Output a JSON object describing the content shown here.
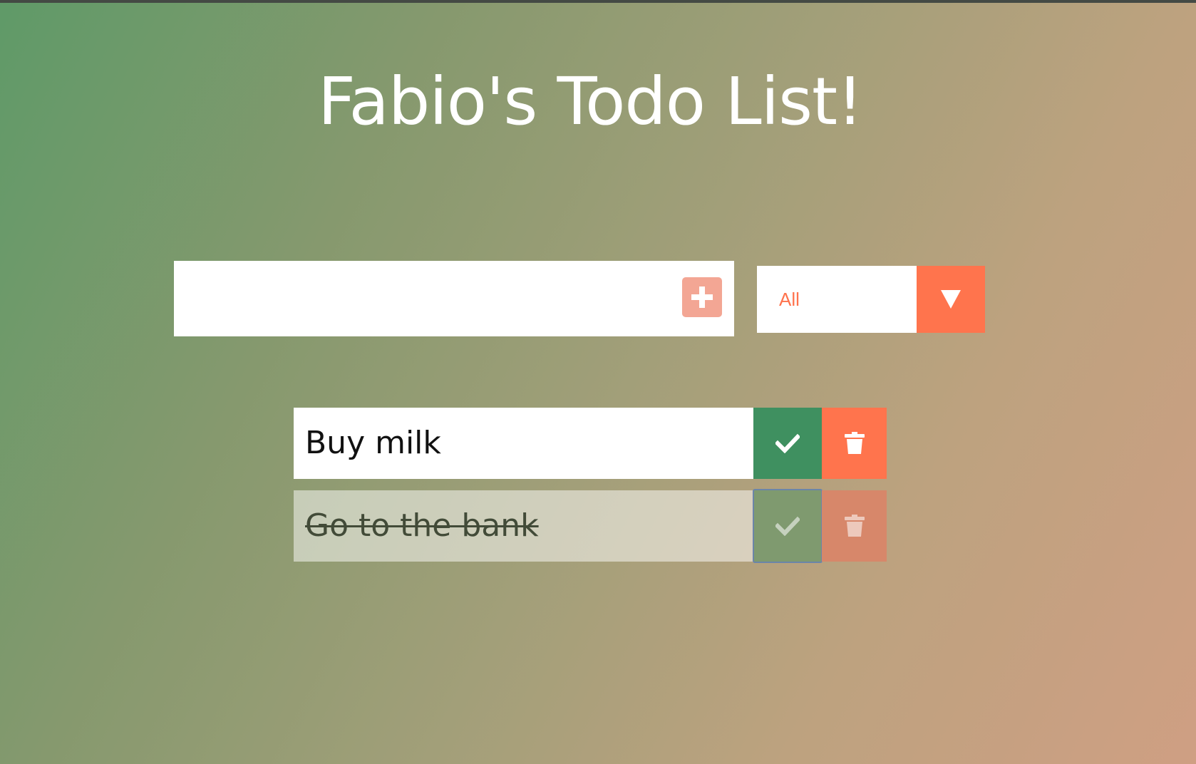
{
  "window": {
    "title": "Fabio's Todo List!"
  },
  "new_todo": {
    "value": "",
    "add_icon": "plus-square-icon"
  },
  "filter": {
    "selected": "All",
    "arrow_icon": "triangle-down-icon"
  },
  "todos": [
    {
      "text": "Buy milk",
      "completed": false,
      "check_icon": "check-icon",
      "delete_icon": "trash-icon"
    },
    {
      "text": "Go to the bank",
      "completed": true,
      "check_icon": "check-icon",
      "delete_icon": "trash-icon"
    }
  ],
  "colors": {
    "accent": "#ff744d",
    "check": "#3f9060",
    "add": "#f3a694"
  }
}
